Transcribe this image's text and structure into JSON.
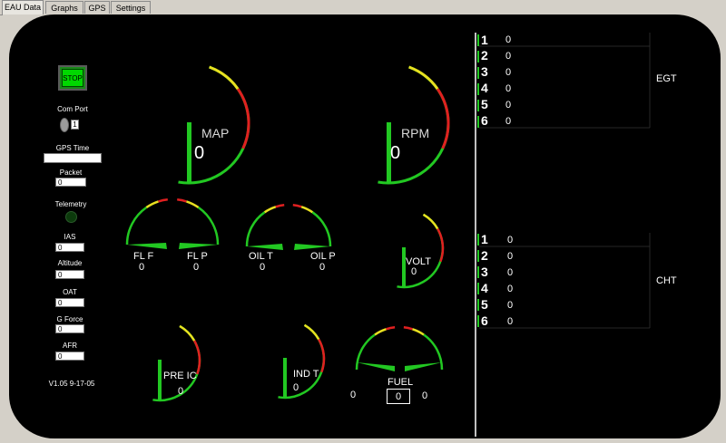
{
  "tabs": [
    "EAU Data",
    "Graphs",
    "GPS",
    "Settings"
  ],
  "controls": {
    "stop_label": "STOP",
    "com_port_label": "Com Port",
    "com_port_value": "1",
    "gps_time_label": "GPS Time",
    "gps_time_value": "",
    "packet_label": "Packet",
    "packet_value": "0",
    "telemetry_label": "Telemetry",
    "ias_label": "IAS",
    "ias_value": "0",
    "altitude_label": "Altitude",
    "altitude_value": "0",
    "oat_label": "OAT",
    "oat_value": "0",
    "gforce_label": "G Force",
    "gforce_value": "0",
    "afr_label": "AFR",
    "afr_value": "0",
    "version": "V1.05 9-17-05"
  },
  "gauges": {
    "map": {
      "label": "MAP",
      "value": "0"
    },
    "rpm": {
      "label": "RPM",
      "value": "0"
    },
    "fl_f": {
      "label": "FL F",
      "value": "0"
    },
    "fl_p": {
      "label": "FL P",
      "value": "0"
    },
    "oil_t": {
      "label": "OIL T",
      "value": "0"
    },
    "oil_p": {
      "label": "OIL P",
      "value": "0"
    },
    "volt": {
      "label": "VOLT",
      "value": "0"
    },
    "pre_ic": {
      "label": "PRE IC",
      "value": "0"
    },
    "ind_t": {
      "label": "IND T",
      "value": "0"
    },
    "fuel": {
      "label": "FUEL",
      "left_value": "0",
      "center_value": "0",
      "right_value": "0"
    }
  },
  "egt": {
    "label": "EGT",
    "rows": [
      {
        "num": "1",
        "value": "0"
      },
      {
        "num": "2",
        "value": "0"
      },
      {
        "num": "3",
        "value": "0"
      },
      {
        "num": "4",
        "value": "0"
      },
      {
        "num": "5",
        "value": "0"
      },
      {
        "num": "6",
        "value": "0"
      }
    ]
  },
  "cht": {
    "label": "CHT",
    "rows": [
      {
        "num": "1",
        "value": "0"
      },
      {
        "num": "2",
        "value": "0"
      },
      {
        "num": "3",
        "value": "0"
      },
      {
        "num": "4",
        "value": "0"
      },
      {
        "num": "5",
        "value": "0"
      },
      {
        "num": "6",
        "value": "0"
      }
    ]
  },
  "colors": {
    "green": "#22c822",
    "yellow": "#e8e020",
    "red": "#e02020",
    "background": "#000000"
  }
}
